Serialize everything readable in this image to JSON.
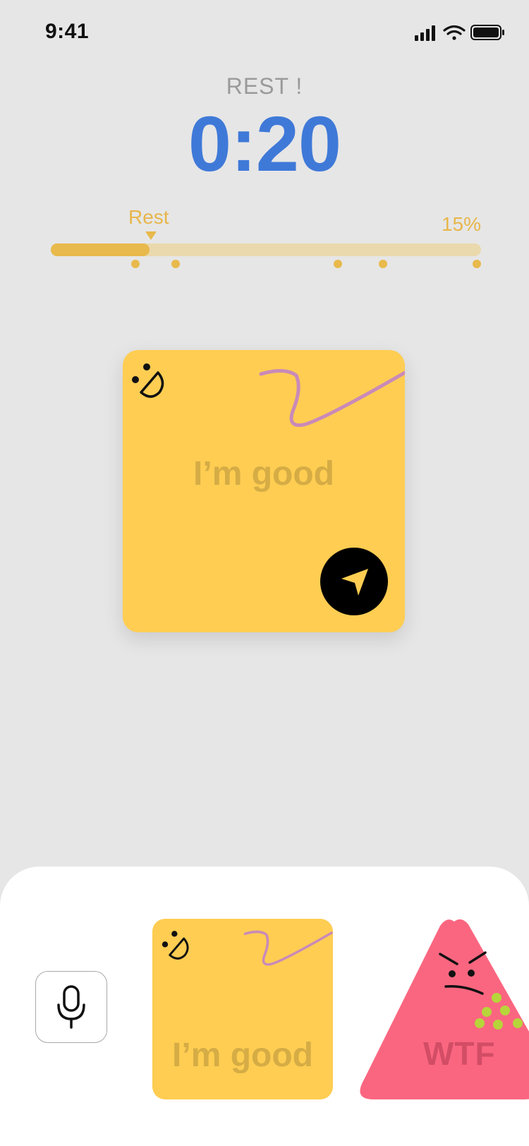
{
  "status_bar": {
    "time": "9:41"
  },
  "workout": {
    "phase": "REST !",
    "timer": "0:20"
  },
  "progress": {
    "label": "Rest",
    "percent_text": "15%",
    "fraction": 0.23
  },
  "card": {
    "text": "I’m good"
  },
  "reactions": [
    {
      "text": "I’m good",
      "color": "#fecd52"
    },
    {
      "text": "WTF",
      "color": "#fa6680"
    }
  ],
  "colors": {
    "accent": "#3f79d8",
    "progress": "#e8b94c",
    "card": "#fecd52",
    "reaction_pink": "#fa6680",
    "squiggle": "#c98ab8"
  }
}
